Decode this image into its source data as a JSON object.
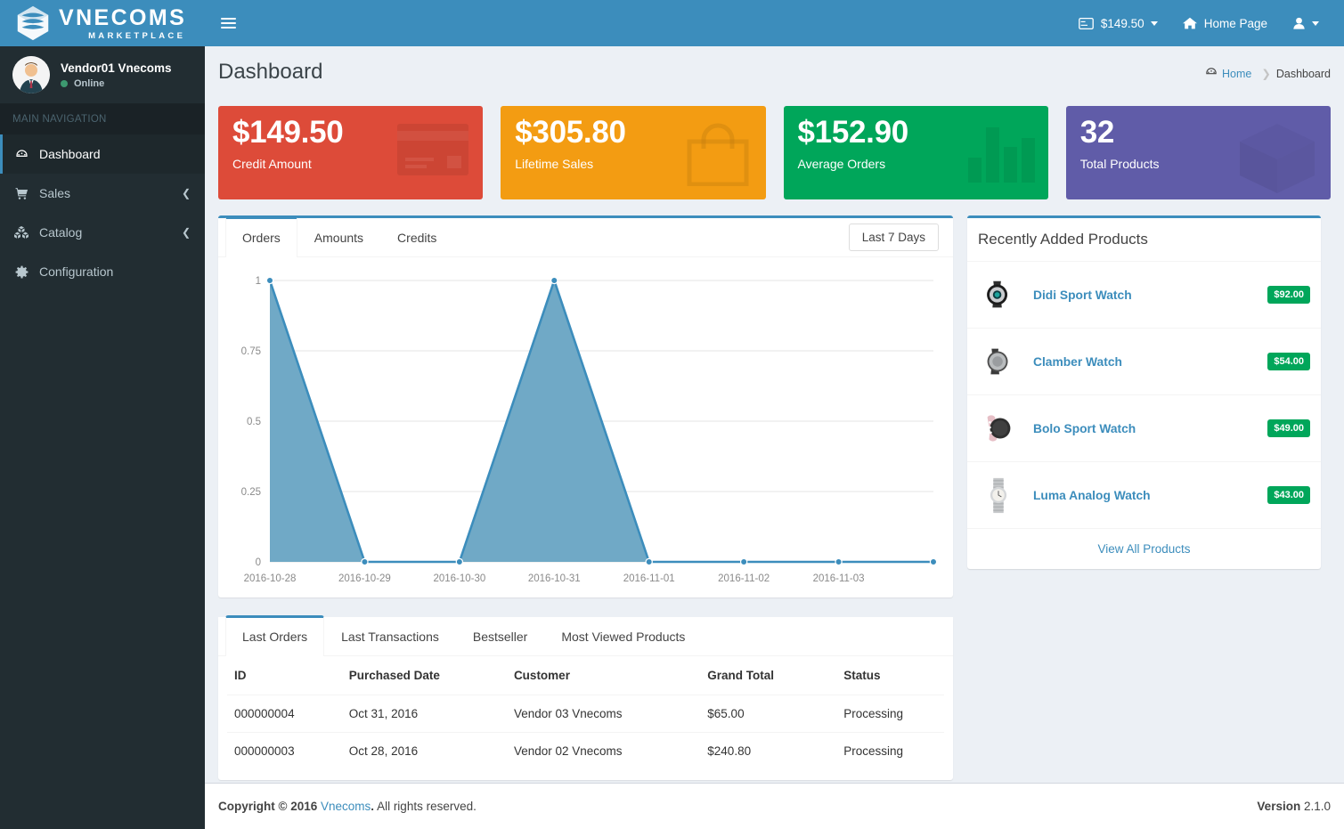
{
  "brand": {
    "name": "VNECOMS",
    "tagline": "MARKETPLACE",
    "logo_icon": "vnecoms-logo-icon"
  },
  "header": {
    "menu_toggle_icon": "hamburger-icon",
    "credit": {
      "icon": "credit-card-icon",
      "label": "$149.50"
    },
    "home": {
      "icon": "home-icon",
      "label": "Home Page"
    },
    "user": {
      "icon": "user-icon"
    }
  },
  "sidebar": {
    "user": {
      "name": "Vendor01 Vnecoms",
      "status": "Online",
      "avatar_icon": "user-avatar-icon"
    },
    "nav_header": "MAIN NAVIGATION",
    "items": [
      {
        "label": "Dashboard",
        "icon": "dashboard-icon",
        "active": true,
        "expandable": false
      },
      {
        "label": "Sales",
        "icon": "cart-icon",
        "active": false,
        "expandable": true
      },
      {
        "label": "Catalog",
        "icon": "cubes-icon",
        "active": false,
        "expandable": true
      },
      {
        "label": "Configuration",
        "icon": "gear-icon",
        "active": false,
        "expandable": false
      }
    ]
  },
  "page": {
    "title": "Dashboard",
    "breadcrumb": {
      "home_icon": "dashboard-icon",
      "home": "Home",
      "current": "Dashboard"
    }
  },
  "stats": [
    {
      "value": "$149.50",
      "label": "Credit Amount",
      "color": "#dd4b39",
      "theme": "red",
      "icon": "credit-card-icon"
    },
    {
      "value": "$305.80",
      "label": "Lifetime Sales",
      "color": "#f39c12",
      "theme": "yellow",
      "icon": "shopping-bag-icon"
    },
    {
      "value": "$152.90",
      "label": "Average Orders",
      "color": "#00a65a",
      "theme": "green",
      "icon": "bar-chart-icon"
    },
    {
      "value": "32",
      "label": "Total Products",
      "color": "#605ca8",
      "theme": "purple",
      "icon": "cube-icon"
    }
  ],
  "chart_panel": {
    "tabs": [
      {
        "label": "Orders",
        "active": true
      },
      {
        "label": "Amounts",
        "active": false
      },
      {
        "label": "Credits",
        "active": false
      }
    ],
    "range_button": "Last 7 Days"
  },
  "chart_data": {
    "type": "area",
    "title": "",
    "xlabel": "",
    "ylabel": "",
    "categories": [
      "2016-10-28",
      "2016-10-29",
      "2016-10-30",
      "2016-10-31",
      "2016-11-01",
      "2016-11-02",
      "2016-11-03",
      ""
    ],
    "series": [
      {
        "name": "Orders",
        "values": [
          1,
          0,
          0,
          1,
          0,
          0,
          0,
          0
        ]
      }
    ],
    "ytick_labels": [
      "1",
      "0.75",
      "0.5",
      "0.25",
      "0"
    ],
    "ytick_values": [
      1,
      0.75,
      0.5,
      0.25,
      0
    ],
    "ylim": [
      0,
      1
    ],
    "grid": true,
    "legend": "none",
    "line_color": "#3c8dbc",
    "fill_color": "#70a9c6",
    "point_color": "#3c8dbc"
  },
  "recent_products": {
    "title": "Recently Added Products",
    "items": [
      {
        "name": "Didi Sport Watch",
        "price": "$92.00",
        "thumb": "didi-sport-watch-thumb"
      },
      {
        "name": "Clamber Watch",
        "price": "$54.00",
        "thumb": "clamber-watch-thumb"
      },
      {
        "name": "Bolo Sport Watch",
        "price": "$49.00",
        "thumb": "bolo-sport-watch-thumb"
      },
      {
        "name": "Luma Analog Watch",
        "price": "$43.00",
        "thumb": "luma-analog-watch-thumb"
      }
    ],
    "footer_link": "View All Products"
  },
  "orders_panel": {
    "tabs": [
      {
        "label": "Last Orders",
        "active": true
      },
      {
        "label": "Last Transactions",
        "active": false
      },
      {
        "label": "Bestseller",
        "active": false
      },
      {
        "label": "Most Viewed Products",
        "active": false
      }
    ],
    "columns": [
      "ID",
      "Purchased Date",
      "Customer",
      "Grand Total",
      "Status"
    ],
    "rows": [
      [
        "000000004",
        "Oct 31, 2016",
        "Vendor 03 Vnecoms",
        "$65.00",
        "Processing"
      ],
      [
        "000000003",
        "Oct 28, 2016",
        "Vendor 02 Vnecoms",
        "$240.80",
        "Processing"
      ]
    ]
  },
  "footer": {
    "copyright_pre": "Copyright © 2016",
    "copyright_link": "Vnecoms",
    "copyright_post": "All rights reserved.",
    "version_label": "Version",
    "version_value": "2.1.0"
  }
}
